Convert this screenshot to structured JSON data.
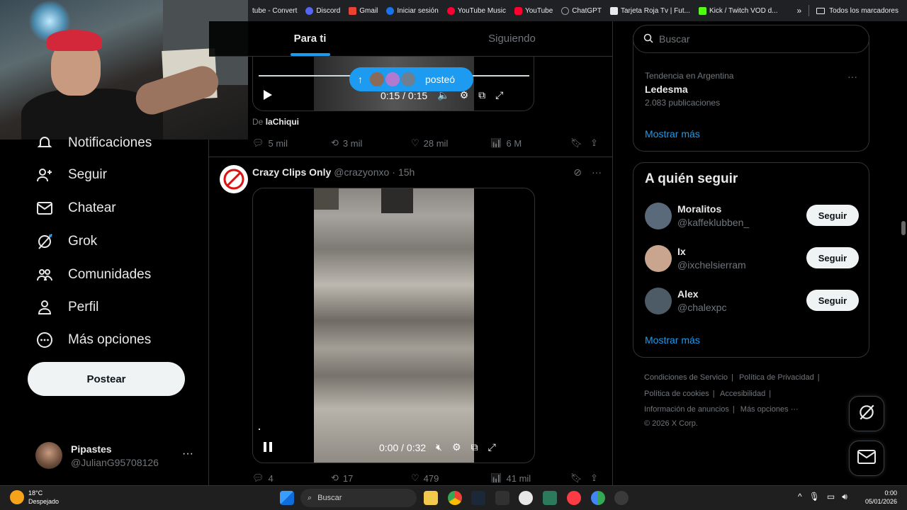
{
  "bookmarks": [
    {
      "label": "tube - Convert",
      "color": "#d93025"
    },
    {
      "label": "Discord",
      "color": "#5865f2"
    },
    {
      "label": "Gmail",
      "color": "#ea4335"
    },
    {
      "label": "Iniciar sesión",
      "color": "#1a73e8"
    },
    {
      "label": "YouTube Music",
      "color": "#ff0033"
    },
    {
      "label": "YouTube",
      "color": "#ff0033"
    },
    {
      "label": "ChatGPT",
      "color": "#9aa0a6"
    },
    {
      "label": "Tarjeta Roja Tv | Fut...",
      "color": "#e8eaed"
    },
    {
      "label": "Kick / Twitch VOD d...",
      "color": "#53fc18"
    }
  ],
  "bookmarks_more": "»",
  "bookmarks_all": "Todos los marcadores",
  "nav": {
    "notifications": "Notificaciones",
    "follow": "Seguir",
    "chat": "Chatear",
    "grok": "Grok",
    "communities": "Comunidades",
    "profile": "Perfil",
    "more": "Más opciones",
    "post_button": "Postear"
  },
  "account": {
    "name": "Pipastes",
    "handle": "@JulianG95708126",
    "more": "···"
  },
  "tabs": {
    "for_you": "Para ti",
    "following": "Siguiendo"
  },
  "posted_pill": {
    "label": "posteó",
    "arrow": "↑"
  },
  "video1": {
    "time": "0:15 / 0:15",
    "progress": 1.0
  },
  "tweet1": {
    "from_prefix": "De",
    "from_name": "laChiqui",
    "replies": "5 mil",
    "reposts": "3 mil",
    "likes": "28 mil",
    "views": "6 M"
  },
  "tweet2": {
    "name": "Crazy Clips Only",
    "handle": "@crazyonxo",
    "dot": "·",
    "time": "15h",
    "video_time": "0:00 / 0:32",
    "progress": 0.0,
    "replies": "4",
    "reposts": "17",
    "likes": "479",
    "views": "41 mil"
  },
  "search": {
    "placeholder": "Buscar"
  },
  "trend": {
    "context": "Tendencia en Argentina",
    "name": "Ledesma",
    "count": "2.083 publicaciones",
    "more": "···",
    "show_more": "Mostrar más"
  },
  "who_to_follow": {
    "title": "A quién seguir",
    "button": "Seguir",
    "users": [
      {
        "name": "Moralitos",
        "handle": "@kaffeklubben_",
        "color": "#5a6a7a"
      },
      {
        "name": "Ix",
        "handle": "@ixchelsierram",
        "color": "#c9a58f"
      },
      {
        "name": "Alex",
        "handle": "@chalexpc",
        "color": "#4d5b66"
      }
    ],
    "show_more": "Mostrar más"
  },
  "footer": {
    "terms": "Condiciones de Servicio",
    "privacy": "Política de Privacidad",
    "cookies": "Política de cookies",
    "accessibility": "Accesibilidad",
    "ads": "Información de anuncios",
    "more": "Más opciones ···",
    "copyright": "© 2026 X Corp."
  },
  "taskbar": {
    "temp": "18°C",
    "weather": "Despejado",
    "search": "Buscar",
    "time": "0:00",
    "date": "05/01/2026"
  },
  "colors": {
    "accent": "#1d9bf0",
    "border": "#2f3336",
    "muted": "#71767b"
  }
}
